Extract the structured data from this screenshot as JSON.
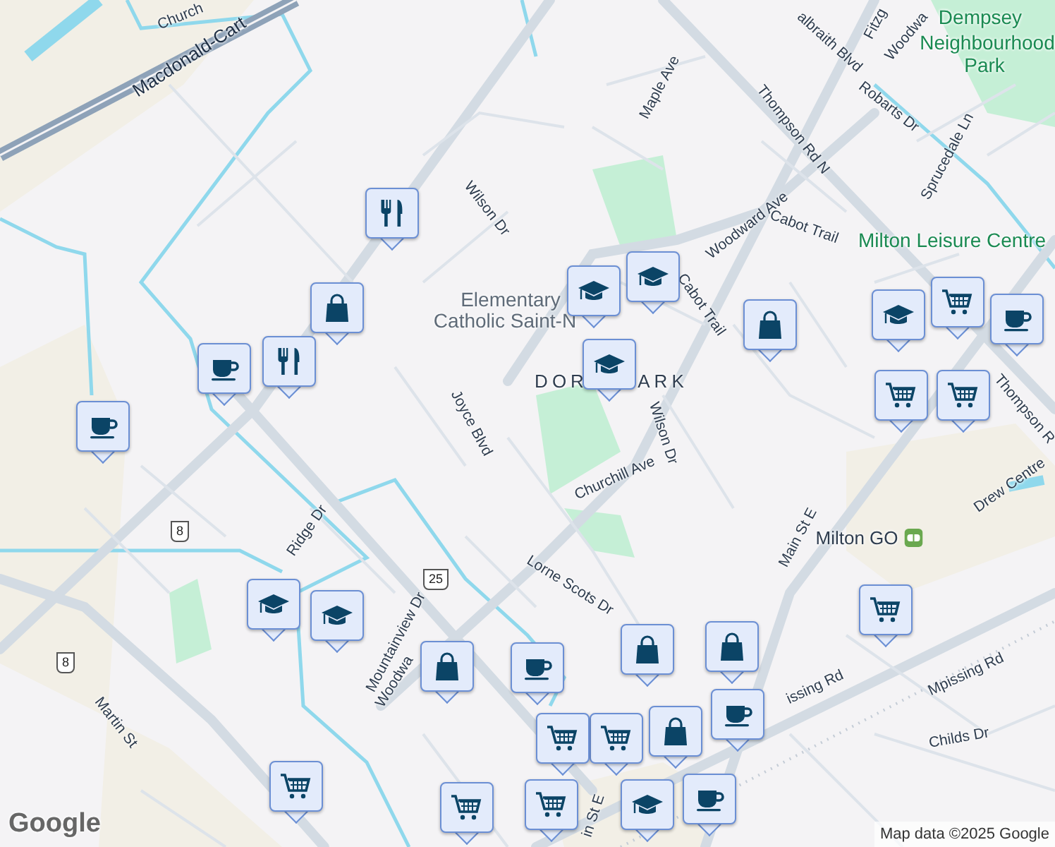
{
  "labels": [
    {
      "text": "Church",
      "kind": "street"
    },
    {
      "text": "Macdonald-Cart",
      "kind": "highway"
    },
    {
      "text": "Wilson Dr",
      "kind": "street"
    },
    {
      "text": "Elementary",
      "kind": "poi"
    },
    {
      "text": "Catholic Saint-N",
      "kind": "poi"
    },
    {
      "text": "DOR",
      "kind": "district"
    },
    {
      "text": "ARK",
      "kind": "district"
    },
    {
      "text": "Joyce Blvd",
      "kind": "street"
    },
    {
      "text": "Wilson Dr",
      "kind": "street"
    },
    {
      "text": "Churchill Ave",
      "kind": "street"
    },
    {
      "text": "Lorne Scots Dr",
      "kind": "street"
    },
    {
      "text": "Maple Ave",
      "kind": "street"
    },
    {
      "text": "Thompson Rd N",
      "kind": "street"
    },
    {
      "text": "Woodward Ave",
      "kind": "street"
    },
    {
      "text": "Cabot Trail",
      "kind": "street"
    },
    {
      "text": "Cabot Trail",
      "kind": "street"
    },
    {
      "text": "albraith Blvd",
      "kind": "street"
    },
    {
      "text": "Fitzg",
      "kind": "street"
    },
    {
      "text": "Woodwa",
      "kind": "street"
    },
    {
      "text": "Dempsey",
      "kind": "park"
    },
    {
      "text": "Neighbourhood",
      "kind": "park"
    },
    {
      "text": "Park",
      "kind": "park"
    },
    {
      "text": "Robarts Dr",
      "kind": "street"
    },
    {
      "text": "Sprucedale Ln",
      "kind": "street"
    },
    {
      "text": "Milton Leisure Centre",
      "kind": "park"
    },
    {
      "text": "Thompson R",
      "kind": "street"
    },
    {
      "text": "Drew Centre",
      "kind": "street"
    },
    {
      "text": "Milton GO",
      "kind": "station"
    },
    {
      "text": "Main St E",
      "kind": "street"
    },
    {
      "text": "Mpissing Rd",
      "kind": "street"
    },
    {
      "text": "issing Rd",
      "kind": "street"
    },
    {
      "text": "Childs Dr",
      "kind": "street"
    },
    {
      "text": "Ridge Dr",
      "kind": "street"
    },
    {
      "text": "Mountainview Dr",
      "kind": "street"
    },
    {
      "text": "Woodwa",
      "kind": "street"
    },
    {
      "text": "Martin St",
      "kind": "street"
    },
    {
      "text": "in St E",
      "kind": "street"
    }
  ],
  "shields": [
    "8",
    "8",
    "25"
  ],
  "markers": [
    {
      "kind": "restaurant"
    },
    {
      "kind": "shopping"
    },
    {
      "kind": "restaurant"
    },
    {
      "kind": "cafe"
    },
    {
      "kind": "cafe"
    },
    {
      "kind": "school"
    },
    {
      "kind": "school"
    },
    {
      "kind": "school"
    },
    {
      "kind": "shopping"
    },
    {
      "kind": "school"
    },
    {
      "kind": "grocery"
    },
    {
      "kind": "cafe"
    },
    {
      "kind": "grocery"
    },
    {
      "kind": "grocery"
    },
    {
      "kind": "school"
    },
    {
      "kind": "school"
    },
    {
      "kind": "shopping"
    },
    {
      "kind": "cafe"
    },
    {
      "kind": "shopping"
    },
    {
      "kind": "shopping"
    },
    {
      "kind": "cafe"
    },
    {
      "kind": "grocery"
    },
    {
      "kind": "shopping"
    },
    {
      "kind": "grocery"
    },
    {
      "kind": "grocery"
    },
    {
      "kind": "cafe"
    },
    {
      "kind": "school"
    },
    {
      "kind": "grocery"
    },
    {
      "kind": "grocery"
    },
    {
      "kind": "grocery"
    }
  ],
  "logo": "Google",
  "attribution": "Map data ©2025 Google"
}
